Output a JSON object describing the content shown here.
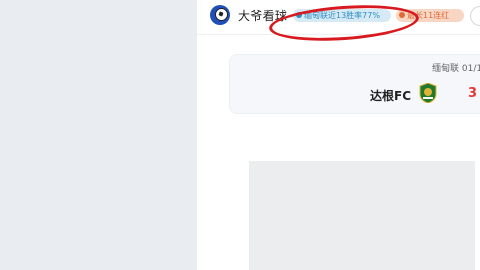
{
  "header": {
    "name": "大爷看球",
    "badges": [
      {
        "label": "缅甸联近13胜率77%",
        "icon": "check-icon",
        "color": "#2f8cc4"
      },
      {
        "label": "最长11连红",
        "icon": "fire-icon",
        "color": "#e06b35"
      }
    ]
  },
  "match": {
    "league": "缅甸联 01/1",
    "team": "达根FC",
    "score": "3"
  },
  "colors": {
    "annotation": "#d8191f",
    "score": "#e53935"
  }
}
